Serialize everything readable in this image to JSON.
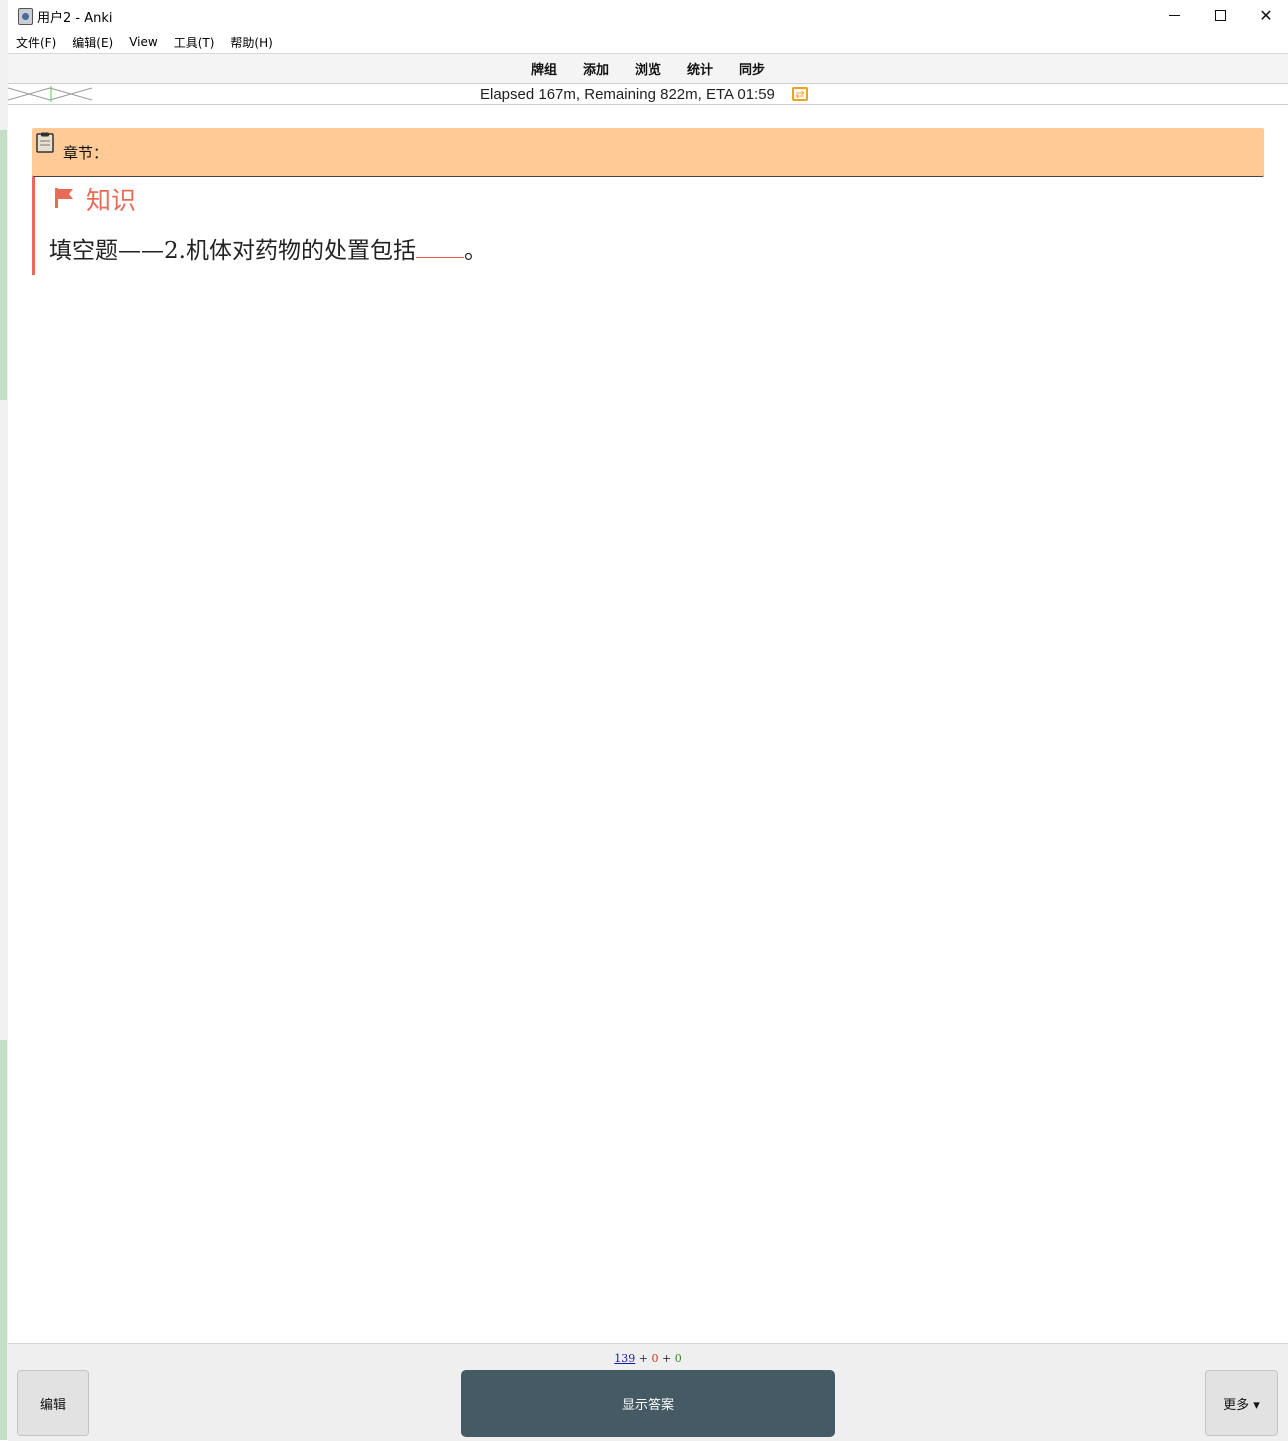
{
  "window": {
    "title": "用户2 - Anki"
  },
  "menu": {
    "items": [
      "文件(F)",
      "编辑(E)",
      "View",
      "工具(T)",
      "帮助(H)"
    ]
  },
  "toolbar": {
    "items": [
      "牌组",
      "添加",
      "浏览",
      "统计",
      "同步"
    ]
  },
  "status": {
    "text": "Elapsed 167m, Remaining 822m, ETA 01:59",
    "sync_icon": "sync-icon",
    "sync_color": "#f0a020"
  },
  "card": {
    "chapter_label": "章节：",
    "chapter_bg": "#ffca96",
    "knowledge_title": "知识",
    "accent_color": "#e96a55",
    "question_text": "填空题——2.机体对药物的处置包括",
    "question_end": "。"
  },
  "bottom": {
    "count_new": "139",
    "count_plus1": "+",
    "count_learn": "0",
    "count_plus2": "+",
    "count_review": "0",
    "edit_label": "编辑",
    "show_answer_label": "显示答案",
    "more_label": "更多 ▾"
  }
}
